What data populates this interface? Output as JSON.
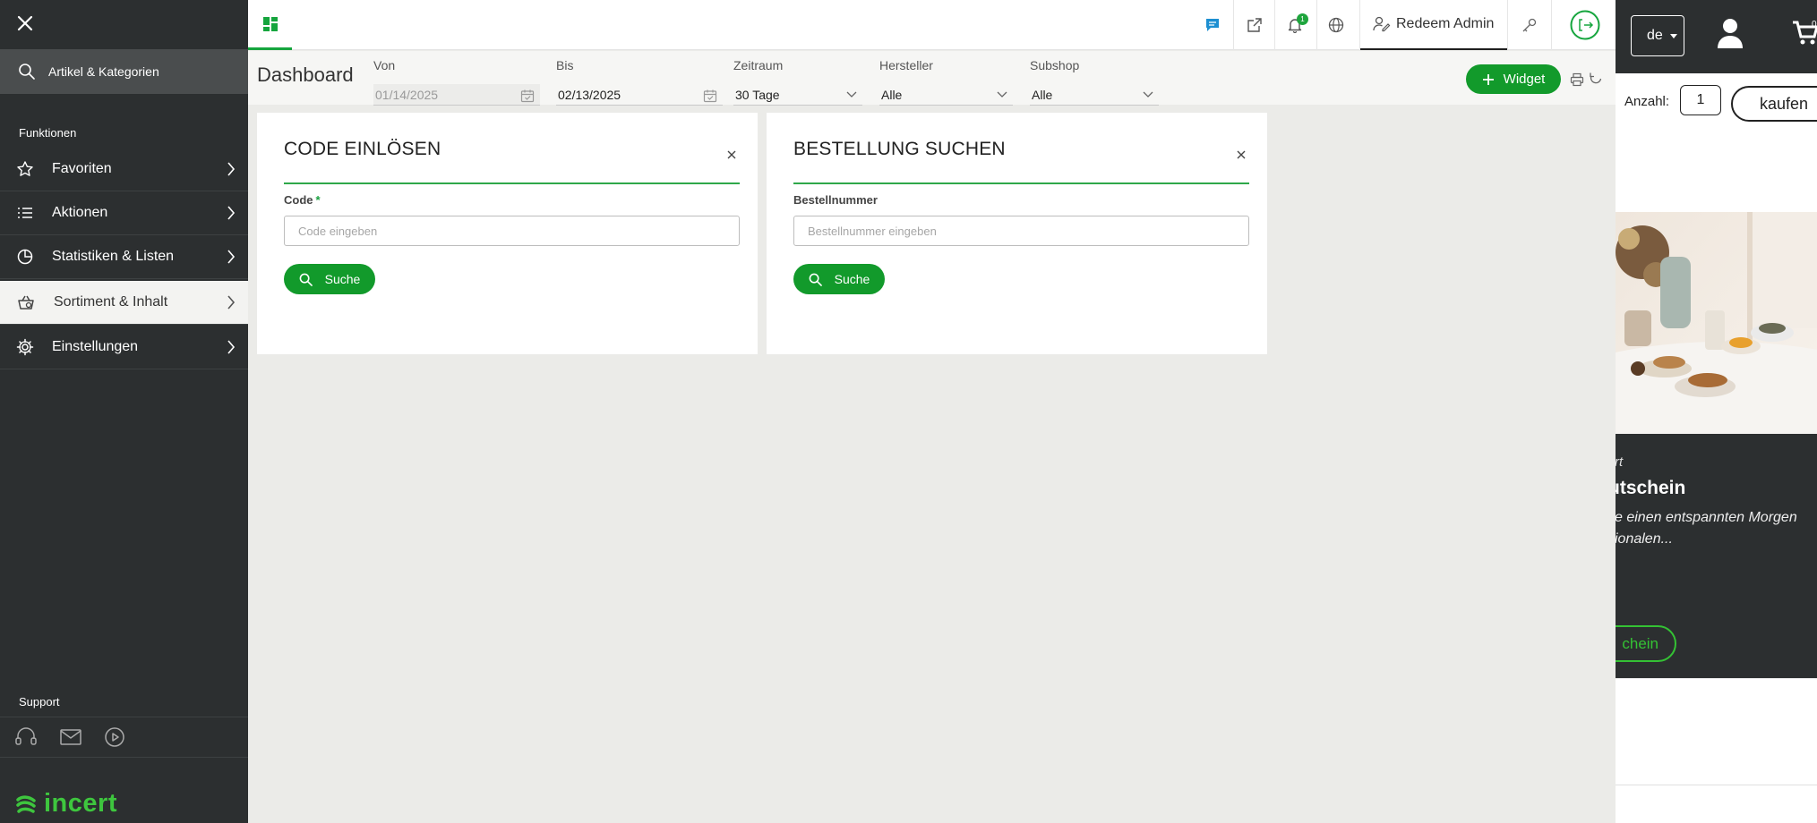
{
  "sidebar": {
    "search_label": "Artikel & Kategorien",
    "section_functions": "Funktionen",
    "items": [
      {
        "label": "Favoriten",
        "icon": "star-icon"
      },
      {
        "label": "Aktionen",
        "icon": "list-icon"
      },
      {
        "label": "Statistiken & Listen",
        "icon": "pie-chart-icon"
      },
      {
        "label": "Sortiment & Inhalt",
        "icon": "basket-icon"
      },
      {
        "label": "Einstellungen",
        "icon": "gear-icon"
      }
    ],
    "section_support": "Support",
    "logo_text": "incert"
  },
  "topbar": {
    "user_label": "Redeem Admin",
    "notification_count": "1"
  },
  "filters": {
    "page_title": "Dashboard",
    "von": {
      "label": "Von",
      "value": "01/14/2025"
    },
    "bis": {
      "label": "Bis",
      "value": "02/13/2025"
    },
    "zeitraum": {
      "label": "Zeitraum",
      "value": "30 Tage"
    },
    "hersteller": {
      "label": "Hersteller",
      "value": "Alle"
    },
    "subshop": {
      "label": "Subshop",
      "value": "Alle"
    },
    "widget_button": "Widget"
  },
  "cards": [
    {
      "title": "CODE EINLÖSEN",
      "field_label": "Code",
      "required_mark": "*",
      "placeholder": "Code eingeben",
      "button": "Suche"
    },
    {
      "title": "BESTELLUNG SUCHEN",
      "field_label": "Bestellnummer",
      "placeholder": "Bestellnummer eingeben",
      "button": "Suche"
    }
  ],
  "site": {
    "language": "de",
    "cart_count": "0",
    "quantity_label": "Anzahl:",
    "quantity_value": "1",
    "buy_button": "kaufen",
    "product_line1": "rt",
    "product_title": "utschein",
    "product_desc1": "e einen entspannten Morgen",
    "product_desc2": "ionalen...",
    "product_button": "chein"
  },
  "colors": {
    "accent": "#129a2b",
    "sidebar_bg": "#2c2f30",
    "content_bg": "#ebebe8"
  }
}
